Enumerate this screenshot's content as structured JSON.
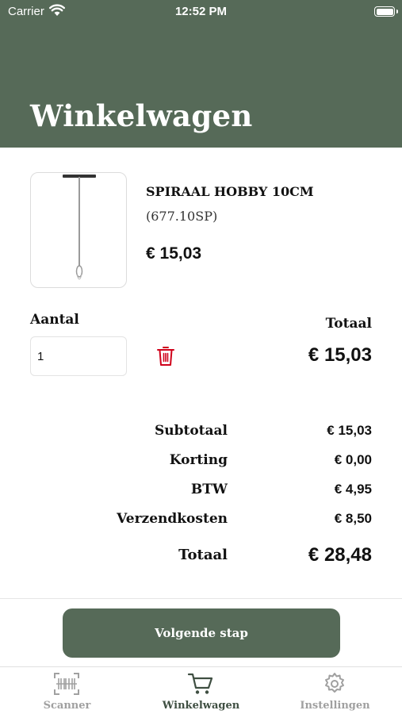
{
  "status_bar": {
    "carrier": "Carrier",
    "time": "12:52 PM"
  },
  "header": {
    "title": "Winkelwagen"
  },
  "colors": {
    "brand": "#566a58",
    "delete": "#d0021b"
  },
  "product": {
    "name": "SPIRAAL HOBBY 10CM",
    "code": "(677.10SP)",
    "price": "€ 15,03",
    "quantity_label": "Aantal",
    "quantity_value": "1",
    "total_label": "Totaal",
    "total_value": "€ 15,03"
  },
  "summary": [
    {
      "label": "Subtotaal",
      "value": "€ 15,03"
    },
    {
      "label": "Korting",
      "value": "€ 0,00"
    },
    {
      "label": "BTW",
      "value": "€ 4,95"
    },
    {
      "label": "Verzendkosten",
      "value": "€ 8,50"
    },
    {
      "label": "Totaal",
      "value": "€ 28,48"
    }
  ],
  "next_button": {
    "label": "Volgende stap"
  },
  "tabbar": {
    "active": "Winkelwagen",
    "items": [
      {
        "label": "Scanner",
        "icon": "barcode-scanner-icon"
      },
      {
        "label": "Winkelwagen",
        "icon": "cart-icon"
      },
      {
        "label": "Instellingen",
        "icon": "gear-icon"
      }
    ]
  }
}
